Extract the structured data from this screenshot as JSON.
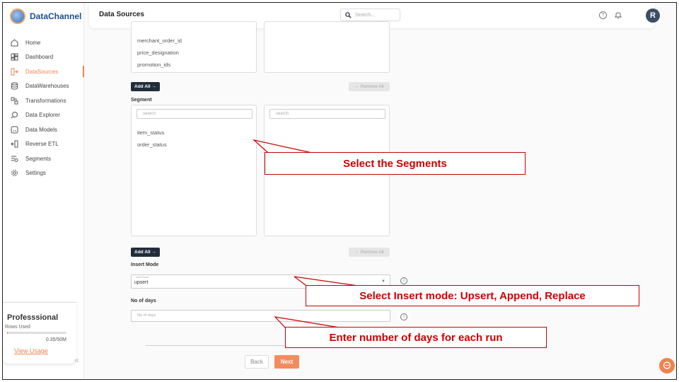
{
  "app": {
    "brand": "DataChannel",
    "page_title": "Data Sources"
  },
  "search": {
    "placeholder": "Search..."
  },
  "user": {
    "avatar_initial": "R"
  },
  "sidebar": {
    "items": [
      {
        "label": "Home",
        "icon": "home-icon"
      },
      {
        "label": "Dashboard",
        "icon": "dashboard-icon"
      },
      {
        "label": "DataSources",
        "icon": "datasources-icon",
        "active": true
      },
      {
        "label": "DataWarehouses",
        "icon": "database-icon"
      },
      {
        "label": "Transformations",
        "icon": "transform-icon"
      },
      {
        "label": "Data Explorer",
        "icon": "explorer-icon"
      },
      {
        "label": "Data Models",
        "icon": "models-icon"
      },
      {
        "label": "Reverse ETL",
        "icon": "reverse-etl-icon"
      },
      {
        "label": "Segments",
        "icon": "segments-icon"
      },
      {
        "label": "Settings",
        "icon": "settings-icon"
      }
    ]
  },
  "plan": {
    "title": "Professsional",
    "rows_used_label": "Rows Used",
    "usage": "0.35/50M",
    "usage_fraction": 0.007,
    "view_usage": "View Usage"
  },
  "metrics_list": {
    "items": [
      "merchant_order_id",
      "price_designation",
      "promotion_ids"
    ]
  },
  "buttons": {
    "add_all": "Add All →",
    "remove_all": "← Remove All",
    "back": "Back",
    "next": "Next"
  },
  "segment": {
    "label": "Segment",
    "search_placeholder_left": "search",
    "search_placeholder_right": "search",
    "items": [
      "item_status",
      "order_status"
    ]
  },
  "insert_mode": {
    "label": "Insert Mode",
    "field_label": "Insert Mode",
    "value": "upsert"
  },
  "days": {
    "label": "No of days",
    "placeholder": "No of days"
  },
  "callouts": {
    "segments": "Select the Segments",
    "insert_mode": "Select Insert mode: Upsert, Append, Replace",
    "days": "Enter number of days for each run"
  },
  "colors": {
    "accent": "#f0824d",
    "dark_button": "#222d3a",
    "callout": "#cc0000"
  }
}
